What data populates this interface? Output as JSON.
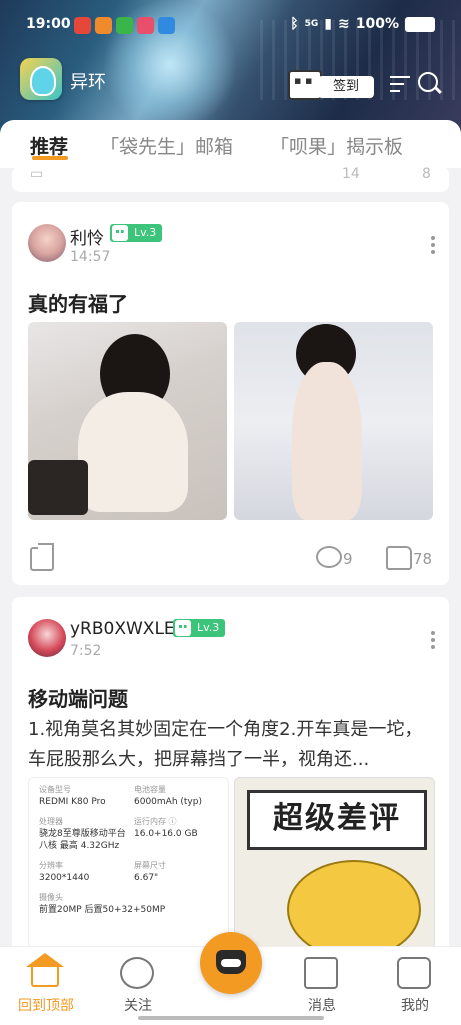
{
  "status_bar": {
    "time": "19:00",
    "battery": "100%",
    "network": "5G"
  },
  "header": {
    "app_name": "异环",
    "signin_label": "签到"
  },
  "tabs": [
    {
      "label": "推荐",
      "active": true
    },
    {
      "label": "「袋先生」邮箱",
      "active": false
    },
    {
      "label": "「呗果」揭示板",
      "active": false
    }
  ],
  "prev_post": {
    "comments": "14",
    "likes": "8"
  },
  "posts": [
    {
      "user": "利怜",
      "level": "Lv.3",
      "time": "14:57",
      "title": "真的有福了",
      "comments": "9",
      "likes": "78"
    },
    {
      "user": "yRB0XWXLE",
      "level": "Lv.3",
      "time": "7:52",
      "title": "移动端问题",
      "body": "1.视角莫名其妙固定在一个角度2.开车真是一坨，车屁股那么大，把屏幕挡了一半，视角还...",
      "specs": {
        "device_label": "设备型号",
        "device": "REDMI K80 Pro",
        "battery_label": "电池容量",
        "battery": "6000mAh (typ)",
        "cpu_label": "处理器",
        "cpu": "骁龙8至尊版移动平台 八核 最高 4.32GHz",
        "ram_label": "运行内存 ⓘ",
        "ram": "16.0+16.0 GB",
        "res_label": "分辨率",
        "res": "3200*1440",
        "screen_label": "屏幕尺寸",
        "screen": "6.67\"",
        "camera_label": "摄像头",
        "camera": "前置20MP 后置50+32+50MP"
      },
      "meme_text": "超级差评"
    }
  ],
  "bottom_nav": [
    {
      "label": "回到顶部",
      "active": true
    },
    {
      "label": "关注",
      "active": false
    },
    {
      "label": "消息",
      "active": false
    },
    {
      "label": "我的",
      "active": false
    }
  ],
  "colors": {
    "accent": "#f39a23",
    "level_badge": "#3cc47a"
  }
}
